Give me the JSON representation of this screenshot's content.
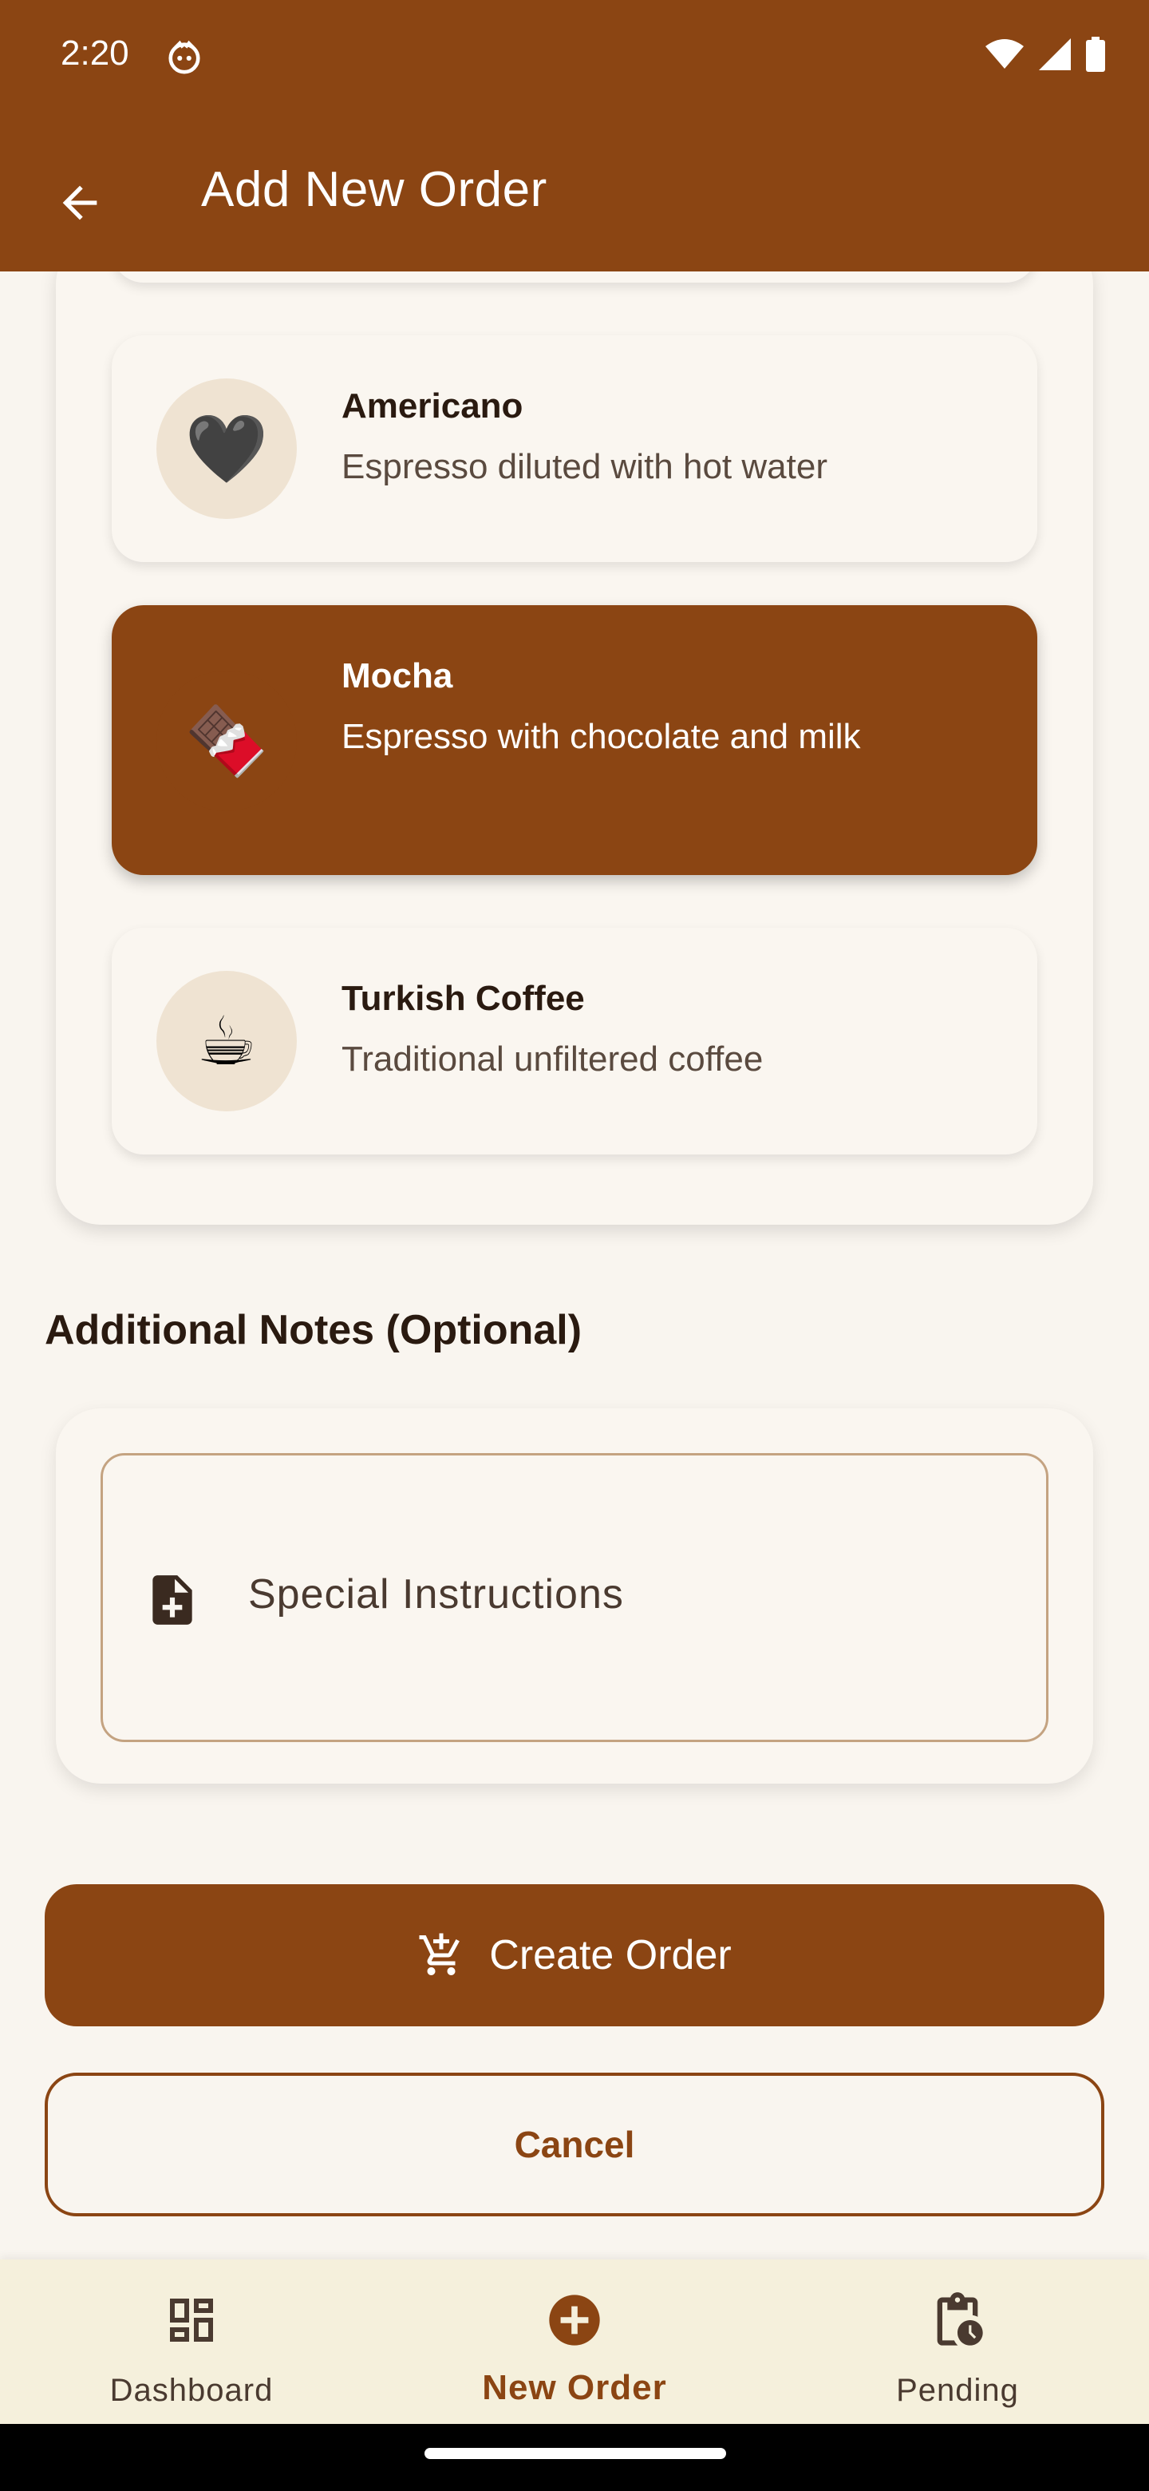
{
  "status_bar": {
    "time": "2:20"
  },
  "app_bar": {
    "title": "Add New Order"
  },
  "drinks": [
    {
      "name": "Americano",
      "description": "Espresso diluted with hot water",
      "emoji": "🖤",
      "selected": false
    },
    {
      "name": "Mocha",
      "description": "Espresso with chocolate and milk",
      "emoji": "🍫",
      "selected": true
    },
    {
      "name": "Turkish Coffee",
      "description": "Traditional unfiltered coffee",
      "emoji": "☕",
      "selected": false
    }
  ],
  "notes_section": {
    "title": "Additional Notes (Optional)",
    "field_label": "Special Instructions"
  },
  "buttons": {
    "create": "Create Order",
    "cancel": "Cancel"
  },
  "bottom_nav": [
    {
      "label": "Dashboard",
      "icon": "dashboard-icon",
      "active": false
    },
    {
      "label": "New Order",
      "icon": "add-circle-icon",
      "active": true
    },
    {
      "label": "Pending",
      "icon": "pending-clipboard-icon",
      "active": false
    }
  ],
  "colors": {
    "primary": "#8B4513",
    "background": "#F9F5EF",
    "nav_background": "#F5F0DC"
  }
}
